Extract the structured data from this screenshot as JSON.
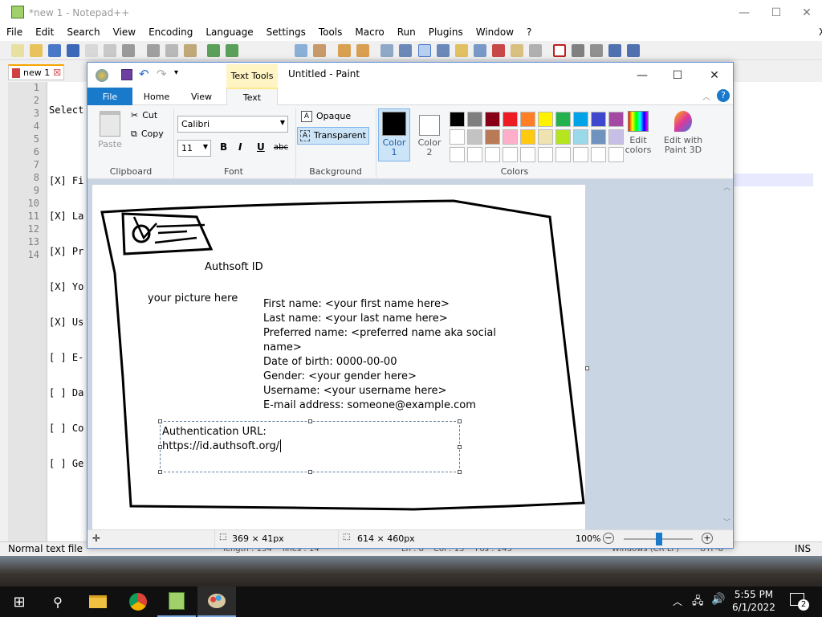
{
  "npp": {
    "title": "*new 1 - Notepad++",
    "menu": [
      "File",
      "Edit",
      "Search",
      "View",
      "Encoding",
      "Language",
      "Settings",
      "Tools",
      "Macro",
      "Run",
      "Plugins",
      "Window",
      "?"
    ],
    "close_x": "X",
    "tab_label": "new 1",
    "line_numbers": [
      "1",
      "2",
      "3",
      "4",
      "5",
      "6",
      "7",
      "8",
      "9",
      "10",
      "11",
      "12",
      "13",
      "14"
    ],
    "lines": [
      "Select",
      "",
      "[X] Fi",
      "[X] La",
      "[X] Pr",
      "[X] Yo",
      "[X] Us",
      "[ ] E-",
      "[ ] Da",
      "[ ] Co",
      "[ ] Ge",
      "",
      "",
      ""
    ],
    "status": {
      "type": "Normal text file",
      "length": "length : 154",
      "lines": "lines : 14",
      "ln": "Ln : 8",
      "col": "Col : 13",
      "pos": "Pos : 143",
      "eol": "Windows (CR LF)",
      "enc": "UTF-8",
      "mode": "INS"
    }
  },
  "paint": {
    "title": "Untitled - Paint",
    "text_tools": "Text Tools",
    "tabs": {
      "file": "File",
      "home": "Home",
      "view": "View",
      "text": "Text"
    },
    "clipboard": {
      "paste": "Paste",
      "cut": "Cut",
      "copy": "Copy",
      "group": "Clipboard"
    },
    "font": {
      "family": "Calibri",
      "size": "11",
      "group": "Font",
      "bold": "B",
      "italic": "I",
      "underline": "U",
      "strike": "abc"
    },
    "background": {
      "opaque": "Opaque",
      "transparent": "Transparent",
      "group": "Background"
    },
    "colors": {
      "color1": "Color\n1",
      "color2": "Color\n2",
      "edit": "Edit\ncolors",
      "paint3d": "Edit with\nPaint 3D",
      "group": "Colors",
      "row1": [
        "#000000",
        "#7f7f7f",
        "#880015",
        "#ed1c24",
        "#ff7f27",
        "#fff200",
        "#22b14c",
        "#00a2e8",
        "#3f48cc",
        "#a349a4"
      ],
      "row2": [
        "#ffffff",
        "#c3c3c3",
        "#b97a57",
        "#ffaec9",
        "#ffc90e",
        "#efe4b0",
        "#b5e61d",
        "#99d9ea",
        "#7092be",
        "#c8bfe7"
      ]
    },
    "canvas_text": {
      "title": "Authsoft ID",
      "picture": "your picture here",
      "fields": [
        "First name: <your first name here>",
        "Last name: <your last name here>",
        "Preferred name: <preferred name aka social",
        "name>",
        "Date of birth: 0000-00-00",
        "Gender: <your gender here>",
        "Username: <your username here>",
        "E-mail address: someone@example.com"
      ],
      "auth_label": "Authentication URL:",
      "auth_url": "https://id.authsoft.org/"
    },
    "status": {
      "selection": "369 × 41px",
      "size": "614 × 460px",
      "zoom": "100%"
    }
  },
  "taskbar": {
    "time": "5:55 PM",
    "date": "6/1/2022",
    "notif": "2"
  }
}
